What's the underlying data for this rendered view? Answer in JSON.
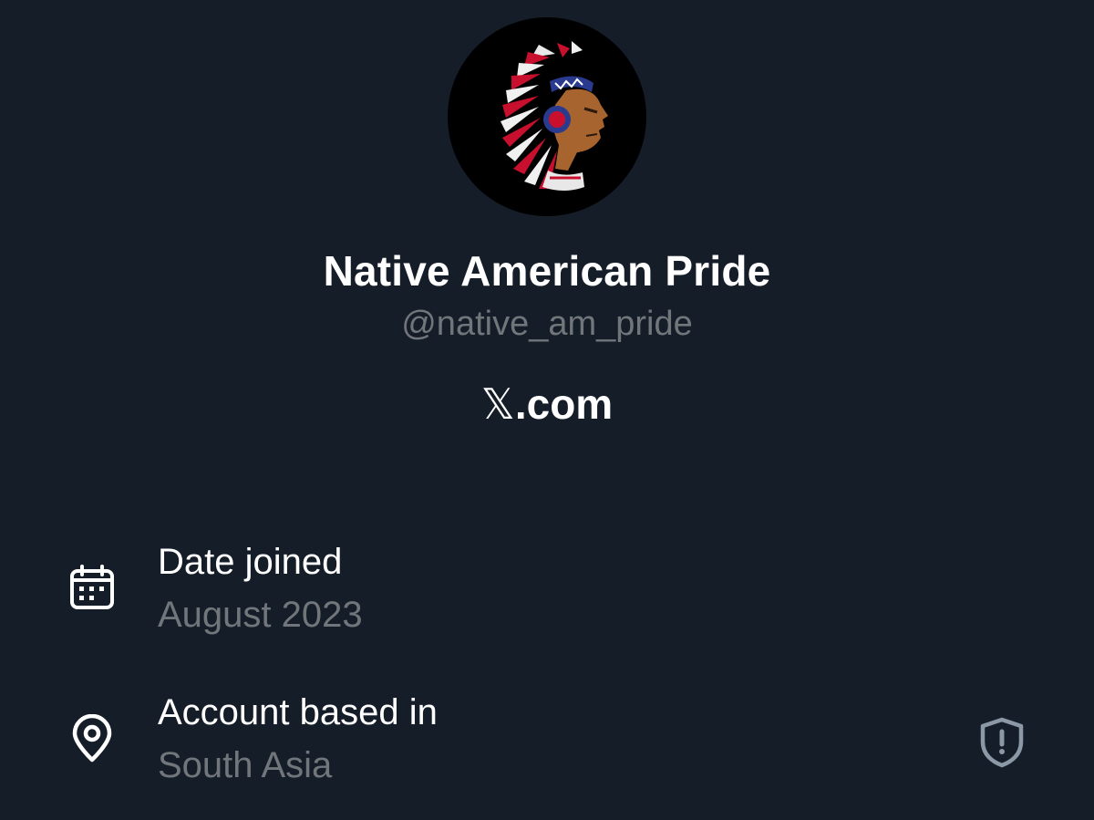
{
  "profile": {
    "display_name": "Native American Pride",
    "handle": "@native_am_pride",
    "avatar_icon": "headdress-portrait-avatar",
    "site_logo_glyph": "𝕏",
    "site_suffix": ".com"
  },
  "about": {
    "date_joined": {
      "label": "Date joined",
      "value": "August 2023",
      "icon": "calendar-icon"
    },
    "account_based_in": {
      "label": "Account based in",
      "value": "South Asia",
      "icon": "location-pin-icon",
      "action_icon": "shield-alert-icon"
    }
  },
  "colors": {
    "background": "#151d28",
    "primary_text": "#ffffff",
    "secondary_text": "#71767b"
  }
}
